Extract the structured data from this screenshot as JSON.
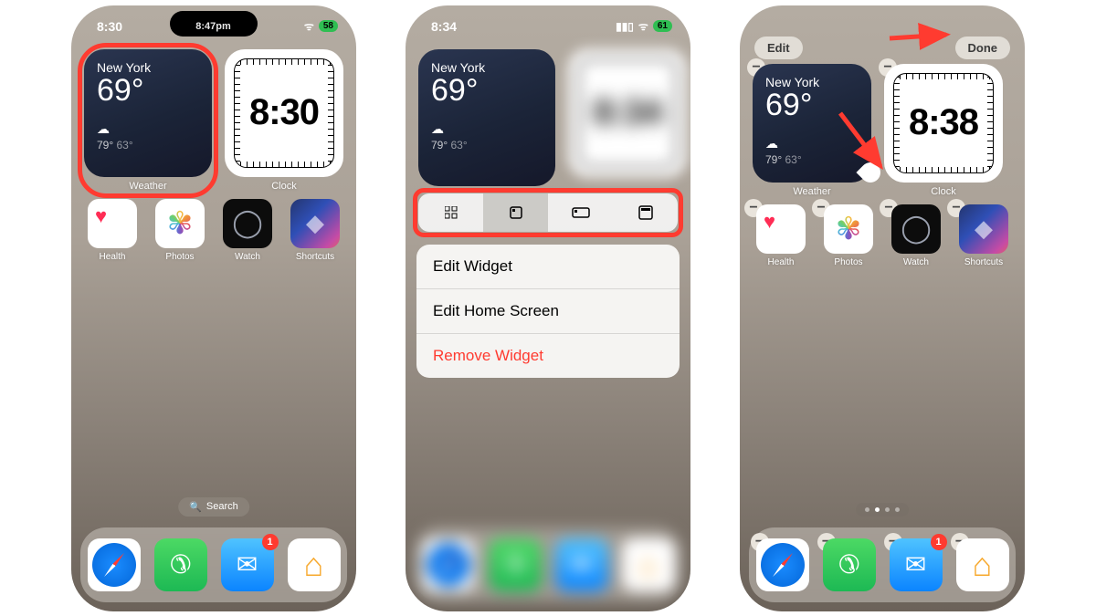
{
  "screen1": {
    "status_time": "8:30",
    "status_center_time": "8:47pm",
    "battery": "58",
    "weather": {
      "city": "New York",
      "temp": "69°",
      "hi": "79°",
      "lo": "63°",
      "label": "Weather"
    },
    "clock": {
      "time": "8:30",
      "label": "Clock"
    },
    "apps": {
      "health": "Health",
      "photos": "Photos",
      "watch": "Watch",
      "shortcuts": "Shortcuts"
    },
    "search": "Search",
    "dock_mail_badge": "1"
  },
  "screen2": {
    "status_time": "8:34",
    "battery": "61",
    "weather": {
      "city": "New York",
      "temp": "69°",
      "hi": "79°",
      "lo": "63°"
    },
    "clock_blur": "8:34",
    "menu": {
      "edit_widget": "Edit Widget",
      "edit_home": "Edit Home Screen",
      "remove": "Remove Widget"
    }
  },
  "screen3": {
    "edit_btn": "Edit",
    "done_btn": "Done",
    "weather": {
      "city": "New York",
      "temp": "69°",
      "hi": "79°",
      "lo": "63°",
      "label": "Weather"
    },
    "clock": {
      "time": "8:38",
      "label": "Clock"
    },
    "apps": {
      "health": "Health",
      "photos": "Photos",
      "watch": "Watch",
      "shortcuts": "Shortcuts"
    },
    "dock_mail_badge": "1"
  }
}
